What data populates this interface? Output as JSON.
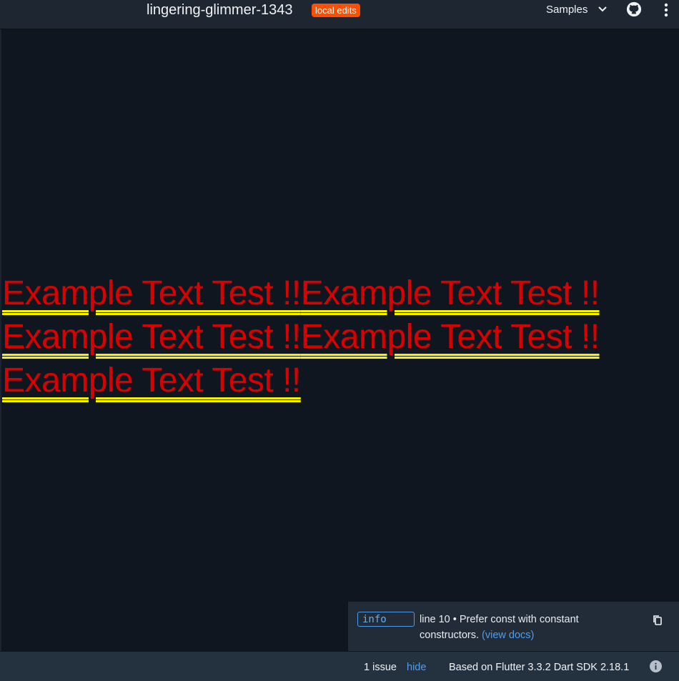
{
  "header": {
    "title": "lingering-glimmer-1343",
    "badge": "local edits",
    "samples_label": "Samples",
    "icons": [
      "chevron-down-icon",
      "github-icon",
      "more-vert-icon"
    ]
  },
  "output": {
    "text_items": [
      "Example Text Test !!",
      "Example Text Test !!",
      "Example Text Test !!",
      "Example Text Test !!",
      "Example Text Test !!"
    ],
    "colors": {
      "text": "#d80000",
      "underline": "#f6f200",
      "background": "#10161f"
    }
  },
  "issue": {
    "severity": "info",
    "message": "line 10 • Prefer const with constant constructors.",
    "docs_link": "(view docs)"
  },
  "status": {
    "issue_count": "1 issue",
    "hide_label": "hide",
    "version": "Based on Flutter 3.3.2 Dart SDK 2.18.1"
  }
}
